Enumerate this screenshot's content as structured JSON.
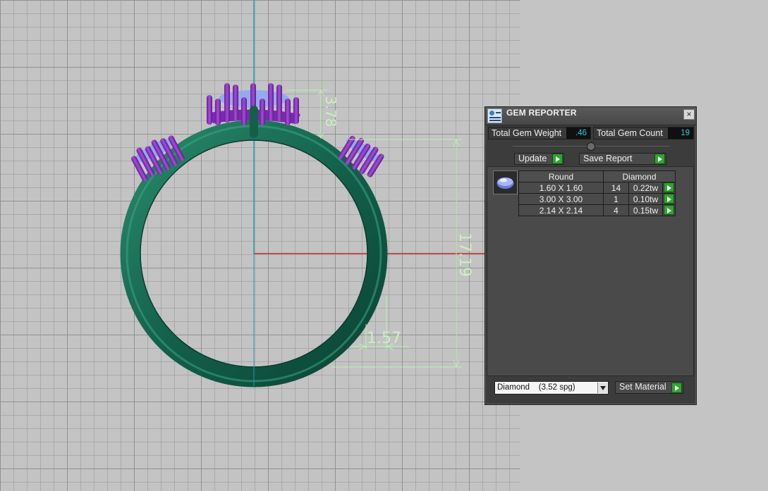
{
  "viewport": {
    "dimensions": {
      "top_height": "3.78",
      "overall_height": "17.19",
      "band_width": "1.57"
    },
    "colors": {
      "ring": "#1a6e55",
      "prongs": "#8a2fc0",
      "stones": "#8fa8f0",
      "dims": "#b8f0b0",
      "x_axis": "#c0301c",
      "y_axis": "#1f9ab8"
    }
  },
  "panel": {
    "title": "GEM REPORTER",
    "icons": {
      "app": "gem-reporter-icon",
      "close": "close-icon"
    },
    "close_label": "×",
    "total_weight_label": "Total Gem Weight",
    "total_weight_value": ".46",
    "total_count_label": "Total Gem Count",
    "total_count_value": "19",
    "update_label": "Update",
    "save_report_label": "Save Report",
    "table": {
      "headers": [
        "Round",
        "Diamond"
      ],
      "rows": [
        {
          "size": "1.60 X 1.60",
          "count": "14",
          "weight": "0.22tw"
        },
        {
          "size": "3.00 X 3.00",
          "count": "1",
          "weight": "0.10tw"
        },
        {
          "size": "2.14 X 2.14",
          "count": "4",
          "weight": "0.15tw"
        }
      ]
    },
    "material_value": "Diamond    (3.52 spg)",
    "set_material_label": "Set Material"
  }
}
